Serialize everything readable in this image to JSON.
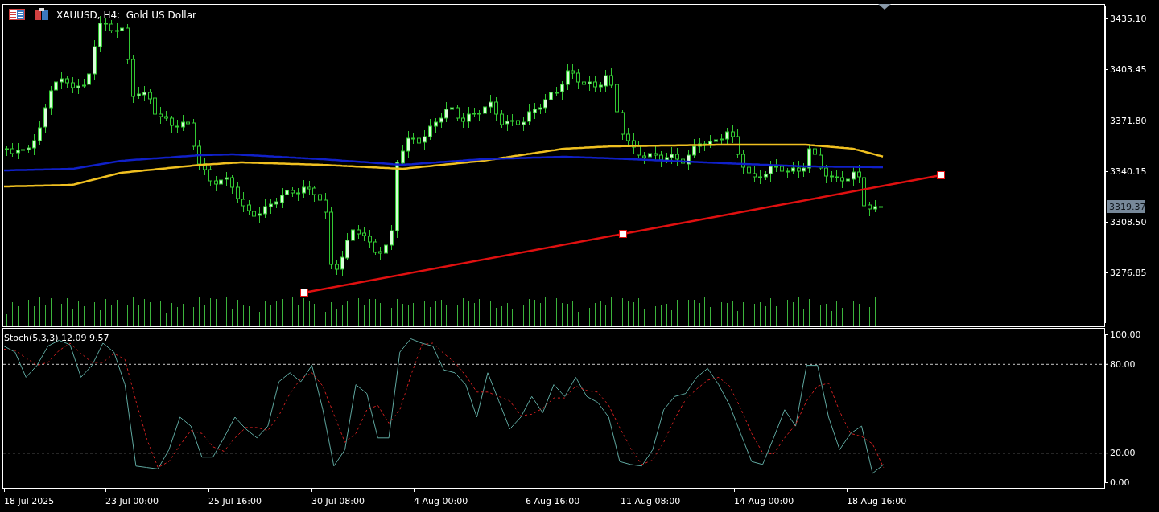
{
  "header": {
    "title": "XAUUSD, H4:  Gold US Dollar"
  },
  "price_axis": [
    "3435.10",
    "3403.45",
    "3371.80",
    "3340.15",
    "3308.50",
    "3276.85"
  ],
  "current_price": "3319.37",
  "indicator": {
    "chart_data": {
      "type": "line",
      "title": "Stoch(5,3,3) 12.09 9.57",
      "ylim": [
        0,
        100
      ],
      "yticks": [
        {
          "value": 100,
          "label": "100.00"
        },
        {
          "value": 80,
          "label": "80.00"
        },
        {
          "value": 20,
          "label": "20.00"
        },
        {
          "value": 0,
          "label": "0.00"
        }
      ],
      "series": [
        {
          "color": "#5fa8a0",
          "line_style": "solid",
          "values": [
            92,
            88,
            71,
            79,
            92,
            96,
            93,
            71,
            79,
            94,
            88,
            66,
            11,
            10,
            9,
            22,
            44,
            38,
            17,
            17,
            30,
            44,
            36,
            30,
            38,
            68,
            74,
            68,
            79,
            49,
            11,
            22,
            66,
            60,
            30,
            30,
            88,
            97,
            94,
            92,
            76,
            74,
            66,
            44,
            74,
            55,
            36,
            44,
            58,
            47,
            66,
            58,
            71,
            58,
            54,
            44,
            14,
            12,
            11,
            22,
            49,
            58,
            60,
            71,
            77,
            66,
            52,
            33,
            14,
            12,
            30,
            49,
            38,
            79,
            79,
            44,
            22,
            33,
            38,
            6,
            12
          ]
        },
        {
          "color": "#d02020",
          "line_style": "dashed",
          "values": [
            90,
            89,
            84,
            79,
            81,
            89,
            94,
            87,
            81,
            81,
            87,
            83,
            55,
            29,
            10,
            14,
            25,
            35,
            33,
            24,
            21,
            30,
            37,
            37,
            35,
            45,
            60,
            70,
            74,
            65,
            46,
            27,
            33,
            49,
            52,
            40,
            49,
            72,
            93,
            94,
            87,
            81,
            72,
            61,
            61,
            58,
            55,
            45,
            46,
            50,
            57,
            57,
            65,
            62,
            61,
            52,
            37,
            23,
            12,
            15,
            27,
            43,
            56,
            63,
            69,
            71,
            65,
            50,
            33,
            20,
            19,
            30,
            39,
            55,
            65,
            67,
            48,
            33,
            31,
            26,
            10
          ]
        }
      ]
    }
  },
  "time_axis": [
    "18 Jul 2025",
    "23 Jul 00:00",
    "25 Jul 16:00",
    "30 Jul 08:00",
    "4 Aug 00:00",
    "6 Aug 16:00",
    "11 Aug 08:00",
    "14 Aug 00:00",
    "18 Aug 16:00"
  ]
}
